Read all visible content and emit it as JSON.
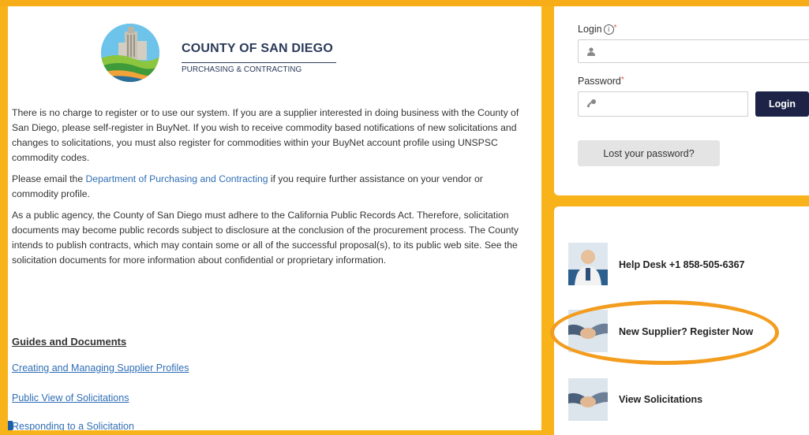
{
  "logo": {
    "title": "COUNTY OF SAN DIEGO",
    "subtitle": "PURCHASING & CONTRACTING"
  },
  "intro": {
    "p1": "There is no charge to register or to use our system. If you are a supplier interested in doing business with the County of San Diego, please self-register in BuyNet. If you wish to receive commodity based notifications of new solicitations and changes to solicitations, you must also register for commodities within your BuyNet account profile using UNSPSC commodity codes.",
    "p2_before": "Please email the ",
    "p2_link": "Department of Purchasing and Contracting",
    "p2_after": " if you require further assistance on your vendor or commodity profile.",
    "p3": "As a public agency, the County of San Diego must adhere to the California Public Records Act. Therefore, solicitation documents may become public records subject to disclosure at the conclusion of the procurement process. The County intends to publish contracts, which may contain some or all of the successful proposal(s), to its public web site. See the solicitation documents for more information about confidential or proprietary information."
  },
  "guides": {
    "title": "Guides and Documents",
    "links": [
      "Creating and Managing Supplier Profiles",
      "Public View of Solicitations",
      "Responding to a Solicitation"
    ]
  },
  "login": {
    "login_label": "Login",
    "info_symbol": "i",
    "required_mark": "*",
    "password_label": "Password",
    "login_value": "",
    "password_value": "",
    "login_button": "Login",
    "lost_password_button": "Lost your password?"
  },
  "side_links": {
    "help_desk": "Help Desk +1 858-505-6367",
    "register": "New Supplier? Register Now",
    "view_solicitations": "View Solicitations"
  },
  "colors": {
    "accent_border": "#f8b31a",
    "highlight": "#f39c1e",
    "login_button": "#1c2346",
    "link": "#2f6eb5"
  }
}
